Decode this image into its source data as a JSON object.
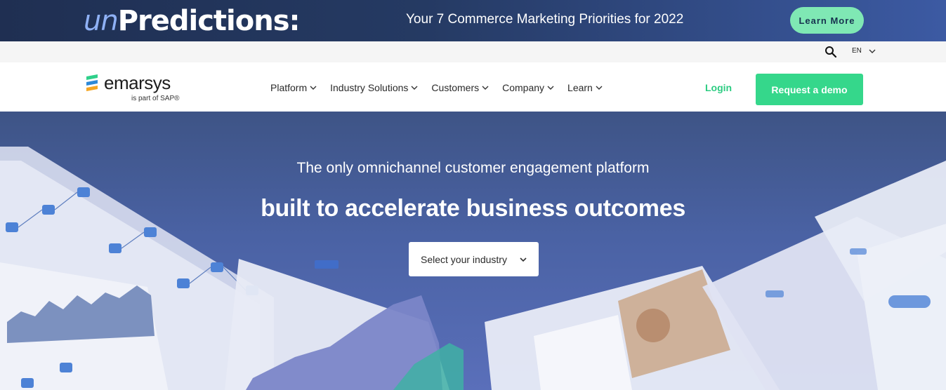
{
  "promo": {
    "title_prefix": "un",
    "title_main": "Predictions:",
    "text": "Your 7 Commerce Marketing Priorities for 2022",
    "button_label": "Learn More"
  },
  "utility": {
    "search_icon": "search-icon",
    "language": "EN"
  },
  "nav": {
    "logo_name": "emarsys",
    "logo_sub": "is part of SAP®",
    "items": [
      {
        "label": "Platform"
      },
      {
        "label": "Industry Solutions"
      },
      {
        "label": "Customers"
      },
      {
        "label": "Company"
      },
      {
        "label": "Learn"
      }
    ],
    "login_label": "Login",
    "demo_label": "Request a demo"
  },
  "hero": {
    "subtitle": "The only omnichannel customer engagement platform",
    "title": "built to accelerate business outcomes",
    "select_label": "Select your industry"
  },
  "colors": {
    "promo_bg": "#253a63",
    "promo_button": "#7fe8b4",
    "accent_green": "#35d78b",
    "hero_bg": "#4a62a4"
  }
}
